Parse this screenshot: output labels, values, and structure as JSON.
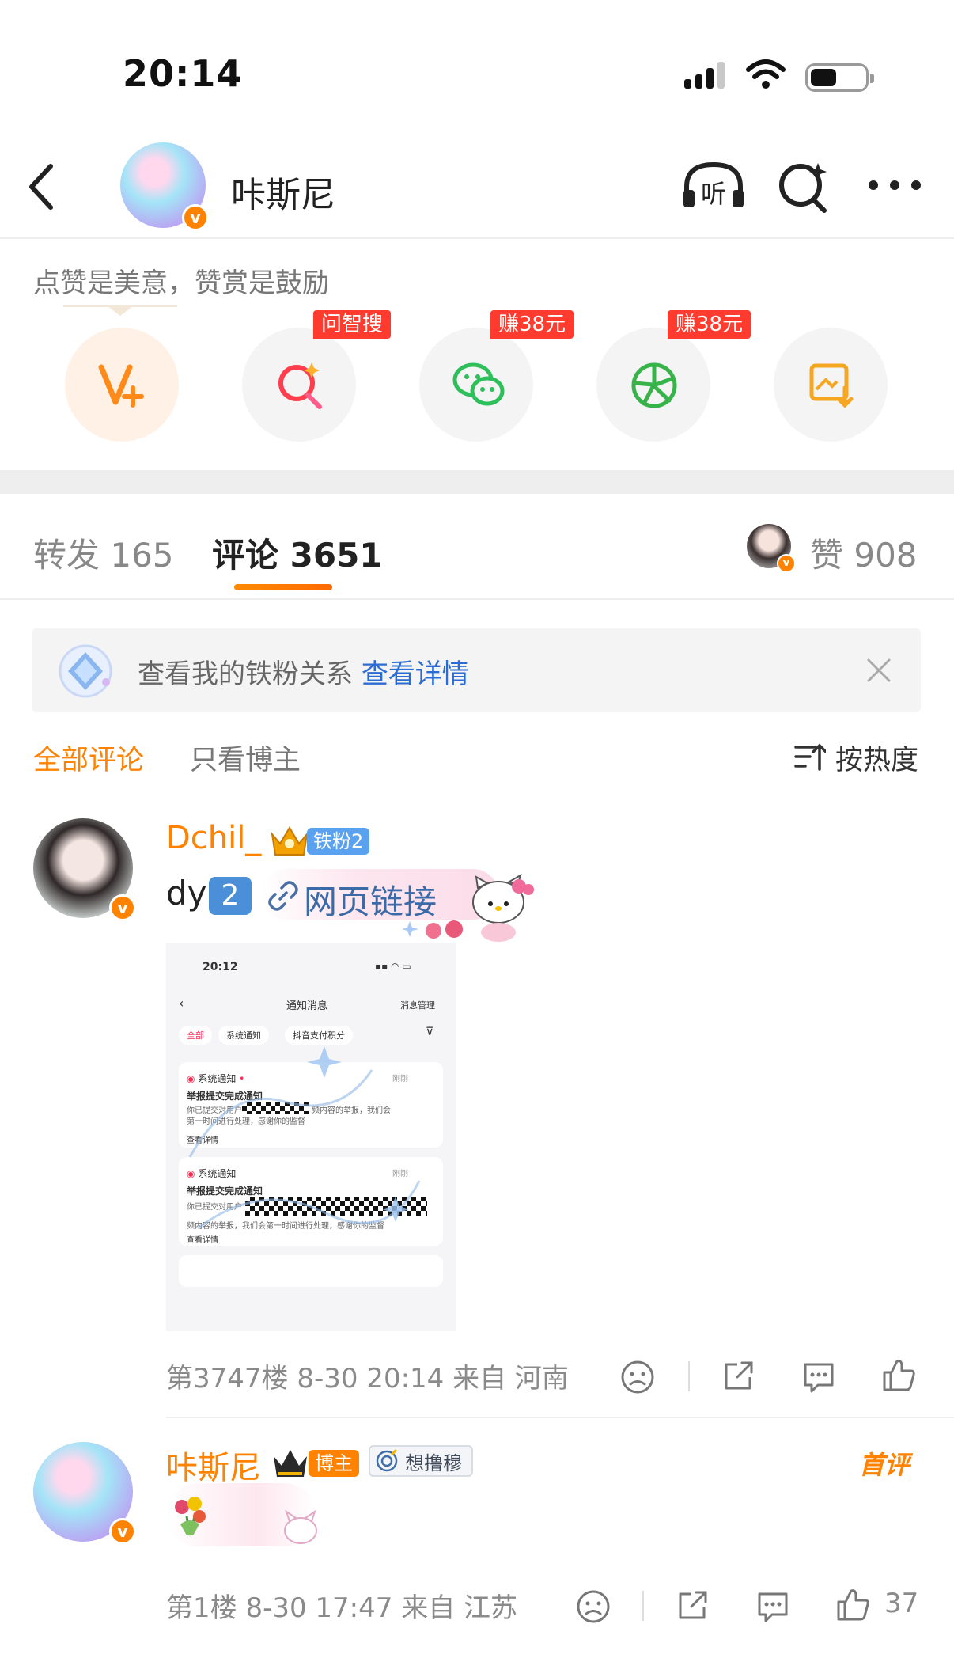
{
  "status_bar": {
    "time": "20:14"
  },
  "header": {
    "title": "咔斯尼"
  },
  "reward": {
    "hint": "点赞是美意，赞赏是鼓励",
    "buttons": [
      {
        "id": "vplus",
        "badge": ""
      },
      {
        "id": "search",
        "badge": "问智搜"
      },
      {
        "id": "wechat",
        "badge": "赚38元"
      },
      {
        "id": "moments",
        "badge": "赚38元"
      },
      {
        "id": "save-image",
        "badge": ""
      }
    ]
  },
  "tabs": {
    "repost": "转发 165",
    "comments": "评论 3651",
    "likes": "赞 908"
  },
  "fan_banner": {
    "text": "查看我的铁粉关系",
    "link": "查看详情"
  },
  "filters": {
    "all": "全部评论",
    "author_only": "只看博主",
    "sort": "按热度"
  },
  "comments": [
    {
      "name": "Dchil_",
      "fan_badge": "铁粉2",
      "text_prefix": "dy",
      "number_badge": "2",
      "link_text": "网页链接",
      "meta": "第3747楼 8-30 20:14 来自 河南",
      "likes": "",
      "image": {
        "time": "20:12",
        "title": "通知消息",
        "manage": "消息管理",
        "chips": [
          "全部",
          "系统通知",
          "抖音支付积分"
        ],
        "cards": [
          {
            "source": "系统通知",
            "when": "刚刚",
            "heading": "举报提交完成通知",
            "line1": "你已提交对用户",
            "line1b": "频内容的举报，我们会",
            "line2": "第一时间进行处理，感谢你的监督",
            "more": "查看详情"
          },
          {
            "source": "系统通知",
            "when": "刚刚",
            "heading": "举报提交完成通知",
            "line1": "你已提交对用户",
            "line2": "频内容的举报，我们会第一时间进行处理，感谢你的监督",
            "more": "查看详情"
          }
        ]
      }
    },
    {
      "name": "咔斯尼",
      "author_badge": "博主",
      "tag": "想撸穆",
      "first_comment": "首评",
      "meta": "第1楼 8-30 17:47 来自 江苏",
      "likes": "37"
    }
  ],
  "colors": {
    "accent": "#ff8200",
    "link": "#2b6cd4",
    "badge_red": "#ff3a2e"
  }
}
